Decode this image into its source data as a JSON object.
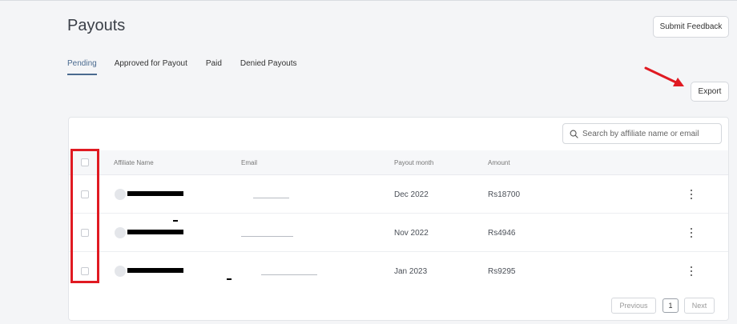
{
  "page": {
    "title": "Payouts"
  },
  "header": {
    "submit_feedback_label": "Submit Feedback"
  },
  "tabs": [
    {
      "label": "Pending",
      "active": true
    },
    {
      "label": "Approved for Payout",
      "active": false
    },
    {
      "label": "Paid",
      "active": false
    },
    {
      "label": "Denied Payouts",
      "active": false
    }
  ],
  "toolbar": {
    "export_label": "Export"
  },
  "search": {
    "placeholder": "Search by affiliate name or email",
    "value": ""
  },
  "table": {
    "columns": [
      "Affiliate Name",
      "Email",
      "Payout month",
      "Amount"
    ],
    "rows": [
      {
        "payout_month": "Dec 2022",
        "amount": "Rs18700"
      },
      {
        "payout_month": "Nov 2022",
        "amount": "Rs4946"
      },
      {
        "payout_month": "Jan 2023",
        "amount": "Rs9295"
      }
    ]
  },
  "pagination": {
    "previous_label": "Previous",
    "current_page": "1",
    "next_label": "Next"
  },
  "annotation": {
    "highlight_color": "#e01a22",
    "arrow_color": "#e01a22"
  },
  "colors": {
    "accent": "#4a6a8f",
    "background": "#f4f5f7"
  }
}
